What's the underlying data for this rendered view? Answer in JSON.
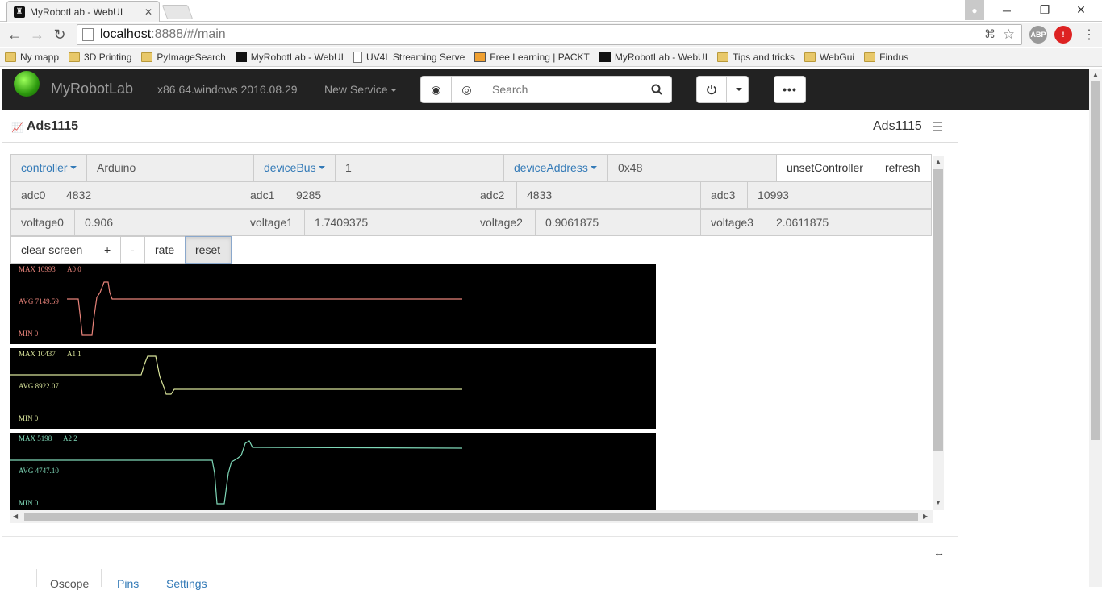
{
  "browser": {
    "tab_title": "MyRobotLab - WebUI",
    "url_host": "localhost",
    "url_path": ":8888/#/main",
    "bookmarks": [
      "Ny mapp",
      "3D Printing",
      "PyImageSearch",
      "MyRobotLab - WebUI",
      "UV4L Streaming Serve",
      "Free Learning | PACKT",
      "MyRobotLab - WebUI",
      "Tips and tricks",
      "WebGui",
      "Findus"
    ],
    "ext_abp": "ABP"
  },
  "app": {
    "brand": "MyRobotLab",
    "version": "x86.64.windows 2016.08.29",
    "new_service": "New Service",
    "search_placeholder": "Search"
  },
  "panel": {
    "name": "Ads1115",
    "type": "Ads1115",
    "controller_label": "controller",
    "controller_value": "Arduino",
    "deviceBus_label": "deviceBus",
    "deviceBus_value": "1",
    "deviceAddress_label": "deviceAddress",
    "deviceAddress_value": "0x48",
    "unset_label": "unsetController",
    "refresh_label": "refresh",
    "adc": [
      {
        "label": "adc0",
        "value": "4832"
      },
      {
        "label": "adc1",
        "value": "9285"
      },
      {
        "label": "adc2",
        "value": "4833"
      },
      {
        "label": "adc3",
        "value": "10993"
      }
    ],
    "voltage": [
      {
        "label": "voltage0",
        "value": "0.906"
      },
      {
        "label": "voltage1",
        "value": "1.7409375"
      },
      {
        "label": "voltage2",
        "value": "0.9061875"
      },
      {
        "label": "voltage3",
        "value": "2.0611875"
      }
    ],
    "scope_buttons": [
      "clear screen",
      "+",
      "-",
      "rate",
      "reset"
    ],
    "scopes": [
      {
        "max": "MAX 10993",
        "ch": "A0 0",
        "avg": "AVG 7149.59",
        "min": "MIN 0",
        "color": "#e8837a"
      },
      {
        "max": "MAX 10437",
        "ch": "A1 1",
        "avg": "AVG 8922.07",
        "min": "MIN 0",
        "color": "#d8e39a"
      },
      {
        "max": "MAX 5198",
        "ch": "A2 2",
        "avg": "AVG 4747.10",
        "min": "MIN 0",
        "color": "#7fd8b8"
      }
    ],
    "bottom_tabs": [
      "Oscope",
      "Pins",
      "Settings"
    ]
  }
}
